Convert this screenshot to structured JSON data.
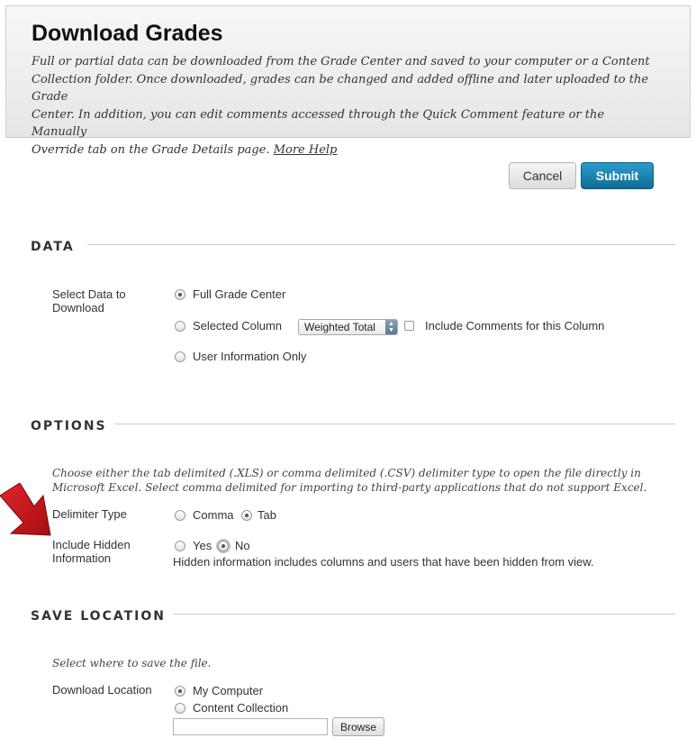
{
  "header": {
    "title": "Download Grades",
    "description_lines": [
      "Full or partial data can be downloaded from the Grade Center and saved to your computer or a Content",
      "Collection folder. Once downloaded, grades can be changed and added offline and later uploaded to the Grade",
      "Center. In addition, you can edit comments accessed through the Quick Comment feature or the Manually",
      "Override tab on the Grade Details page."
    ],
    "more_help": "More Help"
  },
  "actions": {
    "cancel": "Cancel",
    "submit": "Submit"
  },
  "data_section": {
    "title": "DATA",
    "label_lines": [
      "Select Data to",
      "Download"
    ],
    "options": {
      "full": "Full Grade Center",
      "selected": "Selected Column",
      "user_info": "User Information Only"
    },
    "selected_value": "full",
    "column_select": "Weighted Total",
    "include_comments": "Include Comments for this Column",
    "include_comments_checked": false
  },
  "options_section": {
    "title": "OPTIONS",
    "instructions_lines": [
      "Choose either the tab delimited (.XLS) or comma delimited (.CSV) delimiter type to open the file directly in",
      "Microsoft Excel. Select comma delimited for importing to third-party applications that do not support Excel."
    ],
    "delimiter_label": "Delimiter Type",
    "delimiter_options": {
      "comma": "Comma",
      "tab": "Tab"
    },
    "delimiter_value": "tab",
    "hidden_label_lines": [
      "Include Hidden",
      "Information"
    ],
    "hidden_options": {
      "yes": "Yes",
      "no": "No"
    },
    "hidden_value": "no",
    "hidden_note": "Hidden information includes columns and users that have been hidden from view."
  },
  "save_section": {
    "title": "SAVE LOCATION",
    "instructions": "Select where to save the file.",
    "location_label": "Download Location",
    "location_options": {
      "my_computer": "My Computer",
      "content_collection": "Content Collection"
    },
    "location_value": "my_computer",
    "path_value": "",
    "browse": "Browse"
  },
  "colors": {
    "submit_bg": "#1a86b5",
    "arrow": "#c0141a",
    "rule": "#cccccc",
    "header_bg": "#ececec"
  },
  "annotation": {
    "icon": "red-arrow-icon"
  }
}
